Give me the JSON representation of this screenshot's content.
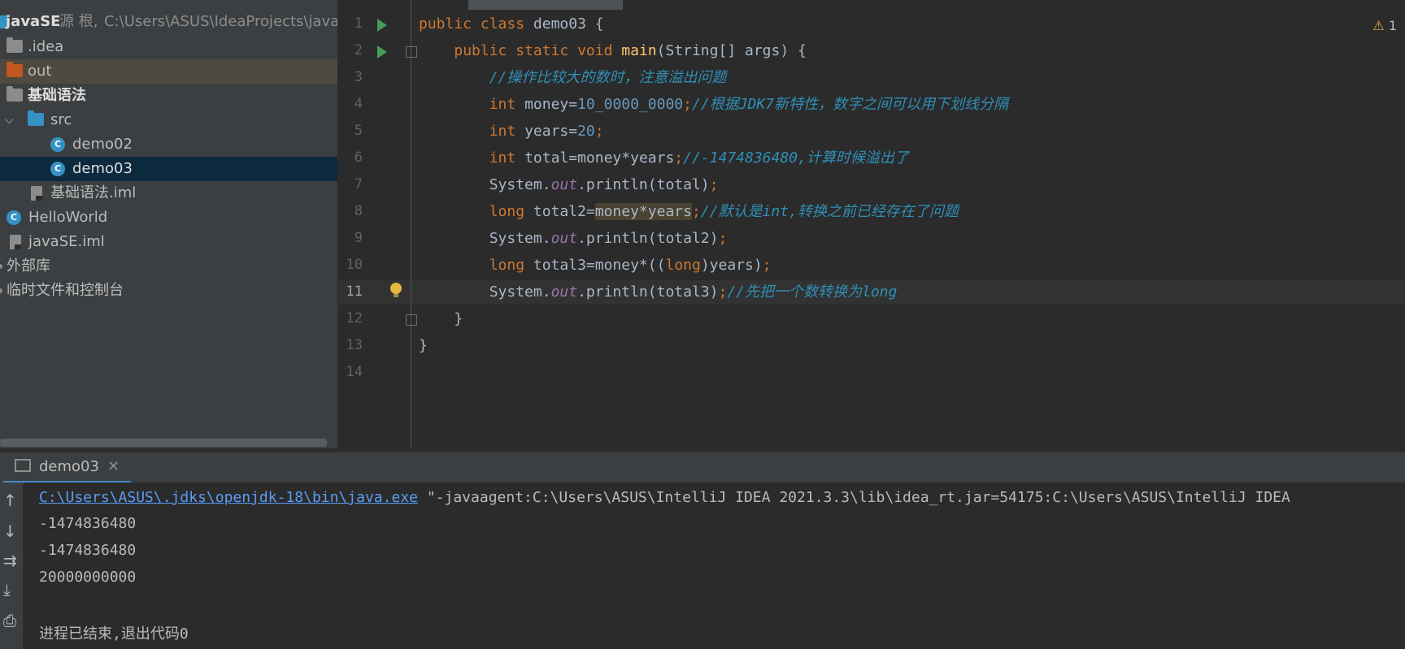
{
  "project": {
    "root": {
      "name": "javaSE",
      "suffix": "源 根,",
      "path": "C:\\Users\\ASUS\\IdeaProjects\\javaSE"
    },
    "items": [
      {
        "label": ".idea"
      },
      {
        "label": "out"
      },
      {
        "label": "基础语法"
      },
      {
        "label": "src"
      },
      {
        "label": "demo02"
      },
      {
        "label": "demo03"
      },
      {
        "label": "基础语法.iml"
      },
      {
        "label": "HelloWorld"
      },
      {
        "label": "javaSE.iml"
      },
      {
        "label": "外部库"
      },
      {
        "label": "临时文件和控制台"
      }
    ]
  },
  "editor": {
    "warning_count": "1",
    "line_numbers": [
      "1",
      "2",
      "3",
      "4",
      "5",
      "6",
      "7",
      "8",
      "9",
      "10",
      "11",
      "12",
      "13",
      "14"
    ],
    "current_line": 11
  },
  "run": {
    "tab_label": "demo03",
    "cmd_link": "C:\\Users\\ASUS\\.jdks\\openjdk-18\\bin\\java.exe",
    "cmd_rest": " \"-javaagent:C:\\Users\\ASUS\\IntelliJ IDEA 2021.3.3\\lib\\idea_rt.jar=54175:C:\\Users\\ASUS\\IntelliJ IDEA",
    "output": [
      "-1474836480",
      "-1474836480",
      "20000000000"
    ],
    "exit_message": "进程已结束,退出代码0"
  },
  "colors": {
    "accent": "#4a88c7",
    "selection": "#0d293e",
    "keyword": "#cc7832",
    "comment": "#2f8fb7"
  }
}
